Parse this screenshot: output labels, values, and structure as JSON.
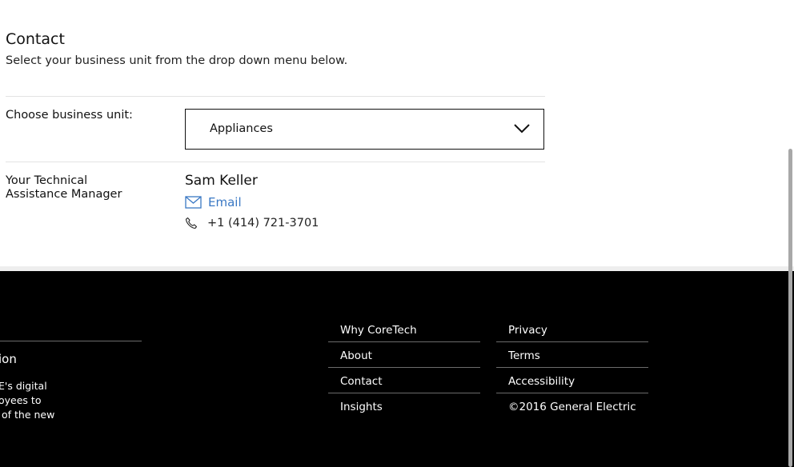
{
  "contact": {
    "title": "Contact",
    "subtitle": "Select your business unit from the drop down menu below."
  },
  "business_unit": {
    "label": "Choose business unit:",
    "selected": "Appliances"
  },
  "manager": {
    "label_line1": "Your Technical",
    "label_line2": "Assistance Manager",
    "name": "Sam Keller",
    "email_label": "Email",
    "phone": "+1 (414) 721-3701"
  },
  "footer": {
    "heading_fragment": "ion",
    "para_lines": [
      "E's digital",
      "oyees to",
      " of the new"
    ],
    "col1": [
      "Why CoreTech",
      "About",
      "Contact",
      "Insights"
    ],
    "col2": [
      "Privacy",
      "Terms",
      "Accessibility"
    ],
    "copyright": "©2016 General Electric"
  },
  "colors": {
    "link_blue": "#3a78c4",
    "footer_bg": "#000000"
  },
  "icons": [
    "chevron-down-icon",
    "mail-icon",
    "phone-icon"
  ]
}
